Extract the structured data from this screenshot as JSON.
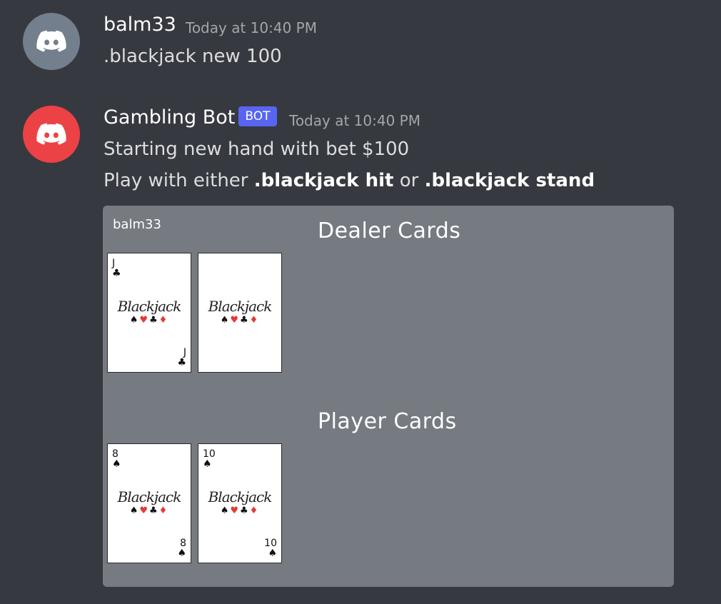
{
  "messages": [
    {
      "username": "balm33",
      "timestamp": "Today at 10:40 PM",
      "text": ".blackjack new 100",
      "avatar_color": "#747f8d",
      "avatar_icon": "discord-logo-icon"
    },
    {
      "username": "Gambling Bot",
      "bot_tag": "BOT",
      "timestamp": "Today at 10:40 PM",
      "line1": "Starting new hand with bet $100",
      "line2_prefix": "Play with either ",
      "cmd_hit": ".blackjack hit",
      "line2_mid": " or ",
      "cmd_stand": ".blackjack stand",
      "avatar_color": "#ed4245",
      "avatar_icon": "discord-logo-icon"
    }
  ],
  "game_image": {
    "player_name": "balm33",
    "dealer_title": "Dealer Cards",
    "player_title": "Player Cards",
    "logo_text": "Blackjack",
    "logo_suits": [
      "♠",
      "♥",
      "♣",
      "♦"
    ],
    "dealer_cards": [
      {
        "rank": "J",
        "suit": "♣",
        "face_up": true
      },
      {
        "rank": "",
        "suit": "",
        "face_up": false
      }
    ],
    "player_cards": [
      {
        "rank": "8",
        "suit": "♠",
        "face_up": true
      },
      {
        "rank": "10",
        "suit": "♠",
        "face_up": true
      }
    ]
  }
}
